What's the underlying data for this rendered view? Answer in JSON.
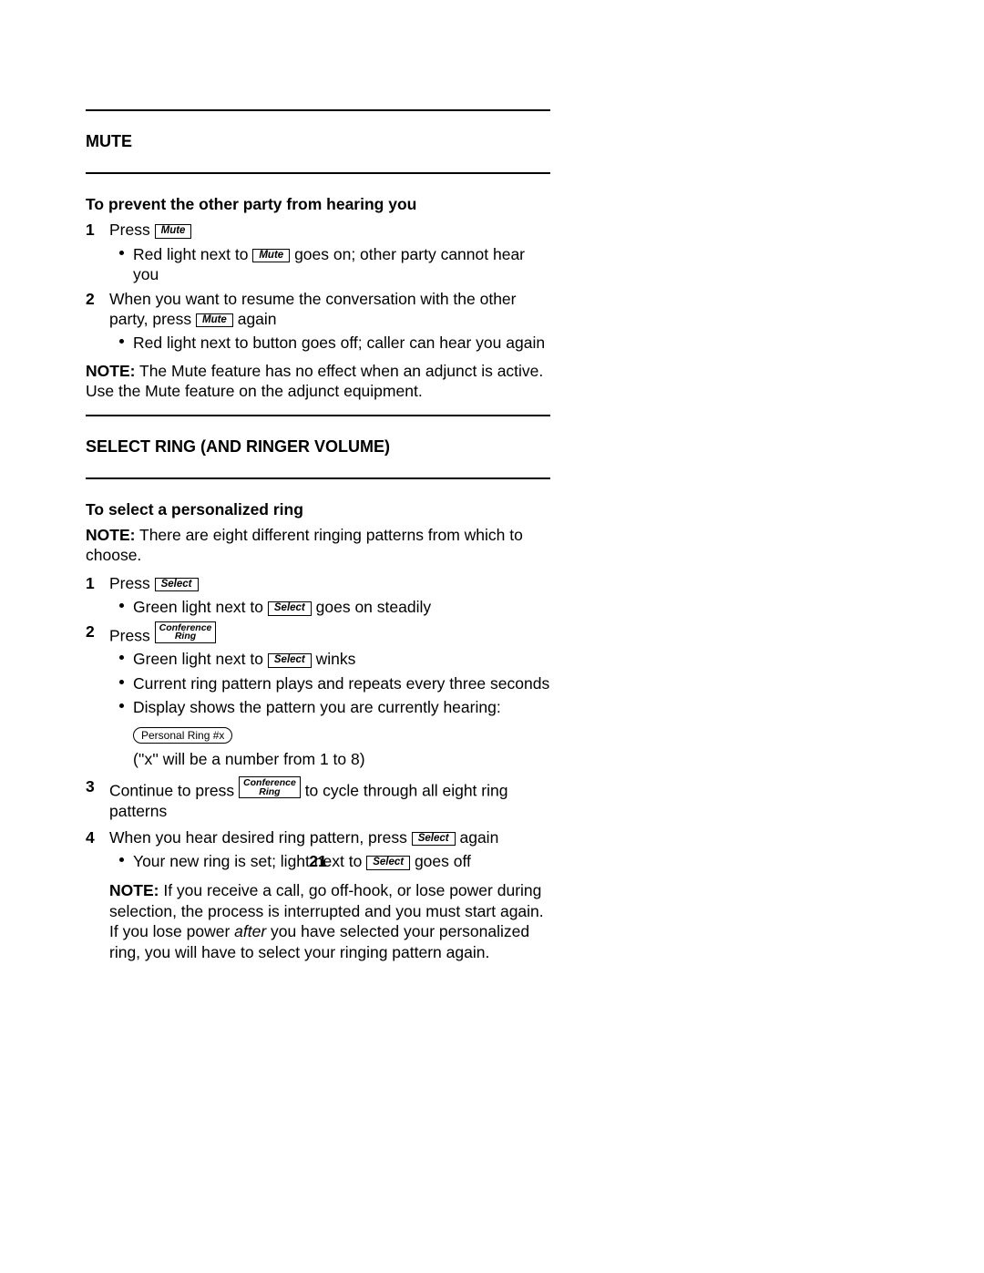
{
  "buttons": {
    "mute": "Mute",
    "select": "Select",
    "conf1": "Conference",
    "conf2": "Ring"
  },
  "display": {
    "personal_ring": "Personal Ring  #x"
  },
  "mute": {
    "title": "MUTE",
    "sub": "To prevent the other party from hearing you",
    "s1_press": "Press",
    "s1_b1a": "Red light next to",
    "s1_b1b": "goes on; other party cannot hear you",
    "s2a": "When you want to resume the conversation with the other party, press",
    "s2b": "again",
    "s2_b1": "Red light next to button goes off; caller can hear you again",
    "note_label": "NOTE:",
    "note": "The Mute feature has no effect when an adjunct is active.  Use the Mute feature on the adjunct equipment."
  },
  "ring": {
    "title": "SELECT RING (AND RINGER VOLUME)",
    "sub": "To select a personalized ring",
    "note0_label": "NOTE:",
    "note0": "There are eight different ringing patterns from which to choose.",
    "s1_press": "Press",
    "s1_b1a": "Green light next to",
    "s1_b1b": "goes on steadily",
    "s2_press": "Press",
    "s2_b1a": "Green light next to",
    "s2_b1b": "winks",
    "s2_b2": "Current ring pattern plays and repeats every three seconds",
    "s2_b3": "Display shows the pattern you are currently hearing:",
    "s2_xnote": "(''x'' will be a number from 1 to 8)",
    "s3a": "Continue to press",
    "s3b": "to cycle through all eight ring patterns",
    "s4a": "When you hear desired ring pattern, press",
    "s4b": "again",
    "s4_b1a": "Your new ring is set; light next to",
    "s4_b1b": "goes off",
    "s4_note_label": "NOTE:",
    "s4_note_a": "If you receive a call, go off-hook, or lose power during selection, the process is interrupted and you must start again.  If you lose power ",
    "s4_note_after": "after",
    "s4_note_b": " you have selected your personalized ring, you will have to select your ringing pattern again."
  },
  "page_number": "21",
  "nums": {
    "n1": "1",
    "n2": "2",
    "n3": "3",
    "n4": "4"
  }
}
